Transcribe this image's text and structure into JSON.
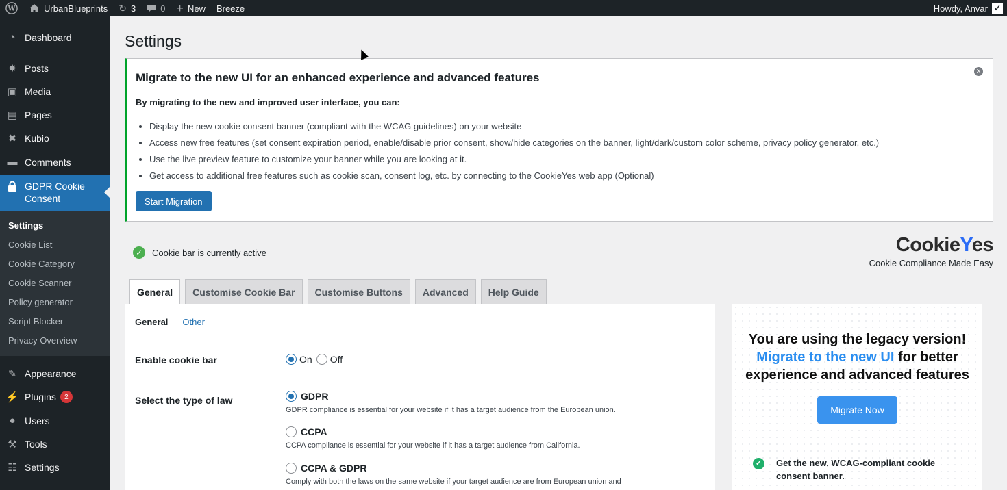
{
  "admin_bar": {
    "site_name": "UrbanBlueprints",
    "updates_count": "3",
    "comments_count": "0",
    "new_label": "New",
    "breeze_label": "Breeze",
    "howdy": "Howdy, Anvar"
  },
  "sidebar": {
    "items": [
      {
        "label": "Dashboard",
        "icon": "dashboard-icon"
      },
      {
        "label": "Posts",
        "icon": "pin-icon"
      },
      {
        "label": "Media",
        "icon": "media-icon"
      },
      {
        "label": "Pages",
        "icon": "pages-icon"
      },
      {
        "label": "Kubio",
        "icon": "kubio-icon"
      },
      {
        "label": "Comments",
        "icon": "comment-icon"
      },
      {
        "label": "GDPR Cookie Consent",
        "label_line1": "GDPR Cookie",
        "label_line2": "Consent",
        "icon": "lock-icon"
      },
      {
        "label": "Appearance",
        "icon": "brush-icon"
      },
      {
        "label": "Plugins",
        "icon": "plugin-icon",
        "badge": "2"
      },
      {
        "label": "Users",
        "icon": "user-icon"
      },
      {
        "label": "Tools",
        "icon": "wrench-icon"
      },
      {
        "label": "Settings",
        "icon": "settings-icon"
      }
    ],
    "submenu": [
      "Settings",
      "Cookie List",
      "Cookie Category",
      "Cookie Scanner",
      "Policy generator",
      "Script Blocker",
      "Privacy Overview"
    ]
  },
  "page": {
    "title": "Settings"
  },
  "notice": {
    "heading": "Migrate to the new UI for an enhanced experience and advanced features",
    "intro": "By migrating to the new and improved user interface, you can:",
    "bullets": [
      "Display the new cookie consent banner (compliant with the WCAG guidelines) on your website",
      "Access new free features (set consent expiration period, enable/disable prior consent, show/hide categories on the banner, light/dark/custom color scheme, privacy policy generator, etc.)",
      "Use the live preview feature to customize your banner while you are looking at it.",
      "Get access to additional free features such as cookie scan, consent log, etc. by connecting to the CookieYes web app (Optional)"
    ],
    "button": "Start Migration"
  },
  "status": {
    "text": "Cookie bar is currently active"
  },
  "brand": {
    "logo_prefix": "Cookie",
    "logo_accent": "Y",
    "logo_suffix": "es",
    "tagline": "Cookie Compliance Made Easy",
    "accent_color": "#2b6cf6"
  },
  "tabs": [
    "General",
    "Customise Cookie Bar",
    "Customise Buttons",
    "Advanced",
    "Help Guide"
  ],
  "subtabs": [
    "General",
    "Other"
  ],
  "form": {
    "enable_label": "Enable cookie bar",
    "enable_on": "On",
    "enable_off": "Off",
    "enable_value": "On",
    "law_label": "Select the type of law",
    "laws": [
      {
        "name": "GDPR",
        "desc": "GDPR compliance is essential for your website if it has a target audience from the European union.",
        "checked": true
      },
      {
        "name": "CCPA",
        "desc": "CCPA compliance is essential for your website if it has a target audience from California.",
        "checked": false
      },
      {
        "name": "CCPA & GDPR",
        "desc": "Comply with both the laws on the same website if your target audience are from European union and",
        "checked": false
      }
    ]
  },
  "promo": {
    "line1": "You are using the legacy version!",
    "link": "Migrate to the new UI",
    "line2_rest": " for better",
    "line3": "experience and advanced features",
    "button": "Migrate Now",
    "feature": "Get the new, WCAG-compliant cookie consent banner."
  },
  "colors": {
    "admin_bg": "#1d2327",
    "accent": "#2271b1",
    "notice_border": "#00a32a",
    "promo_button": "#3a93ee"
  }
}
